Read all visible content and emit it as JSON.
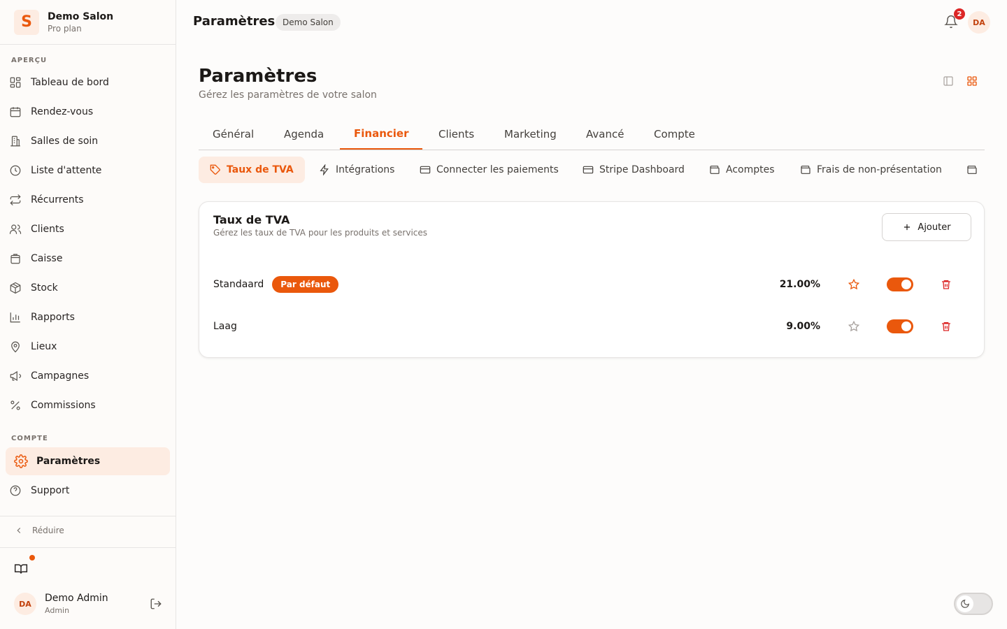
{
  "brand": {
    "logo_letter": "S",
    "name": "Demo Salon",
    "plan": "Pro plan"
  },
  "sidebar": {
    "overview_label": "APERÇU",
    "items": [
      {
        "label": "Tableau de bord",
        "icon": "dashboard-icon"
      },
      {
        "label": "Rendez-vous",
        "icon": "calendar-icon"
      },
      {
        "label": "Salles de soin",
        "icon": "building-icon"
      },
      {
        "label": "Liste d'attente",
        "icon": "clock-icon"
      },
      {
        "label": "Récurrents",
        "icon": "repeat-icon"
      },
      {
        "label": "Clients",
        "icon": "users-icon"
      },
      {
        "label": "Caisse",
        "icon": "bag-icon"
      },
      {
        "label": "Stock",
        "icon": "box-icon"
      },
      {
        "label": "Rapports",
        "icon": "chart-icon"
      },
      {
        "label": "Lieux",
        "icon": "pin-icon"
      },
      {
        "label": "Campagnes",
        "icon": "megaphone-icon"
      },
      {
        "label": "Commissions",
        "icon": "percent-icon"
      }
    ],
    "account_label": "COMPTE",
    "account_items": [
      {
        "label": "Paramètres",
        "icon": "gear-icon",
        "active": true
      },
      {
        "label": "Support",
        "icon": "help-icon"
      }
    ],
    "collapse_label": "Réduire"
  },
  "user": {
    "initials": "DA",
    "name": "Demo Admin",
    "role": "Admin"
  },
  "topbar": {
    "title": "Paramètres",
    "badge": "Demo Salon",
    "notifications": "2",
    "avatar_initials": "DA"
  },
  "page": {
    "title": "Paramètres",
    "subtitle": "Gérez les paramètres de votre salon"
  },
  "tabs": [
    {
      "label": "Général"
    },
    {
      "label": "Agenda"
    },
    {
      "label": "Financier",
      "active": true
    },
    {
      "label": "Clients"
    },
    {
      "label": "Marketing"
    },
    {
      "label": "Avancé"
    },
    {
      "label": "Compte"
    }
  ],
  "subtabs": [
    {
      "label": "Taux de TVA",
      "icon": "tag-icon",
      "active": true
    },
    {
      "label": "Intégrations",
      "icon": "bolt-icon"
    },
    {
      "label": "Connecter les paiements",
      "icon": "card-icon"
    },
    {
      "label": "Stripe Dashboard",
      "icon": "card-icon"
    },
    {
      "label": "Acomptes",
      "icon": "wallet-icon"
    },
    {
      "label": "Frais de non-présentation",
      "icon": "wallet-icon"
    }
  ],
  "vat_card": {
    "title": "Taux de TVA",
    "subtitle": "Gérez les taux de TVA pour les produits et services",
    "add_label": "Ajouter",
    "rows": [
      {
        "name": "Standaard",
        "badge": "Par défaut",
        "rate": "21.00%",
        "is_default": true,
        "enabled": true
      },
      {
        "name": "Laag",
        "badge": "",
        "rate": "9.00%",
        "is_default": false,
        "enabled": true
      }
    ]
  },
  "colors": {
    "accent": "#ea580c",
    "accent_soft": "#fdece2",
    "danger": "#dc2626"
  }
}
